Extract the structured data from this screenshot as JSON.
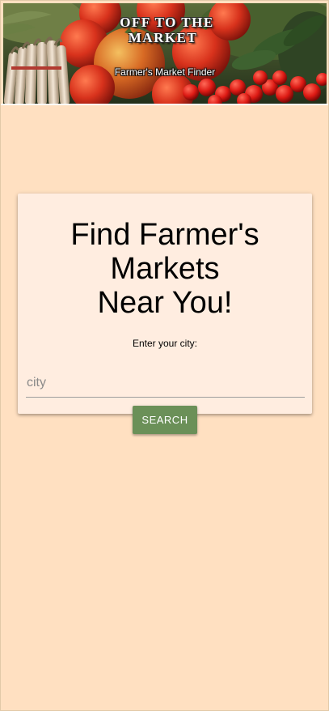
{
  "banner": {
    "logo_line1": "OFF TO THE",
    "logo_line2": "MARKET",
    "subtitle": "Farmer's Market Finder"
  },
  "search_card": {
    "title_line1": "Find Farmer's Markets",
    "title_line2": "Near You!",
    "city_label": "Enter your city:",
    "city_input": {
      "placeholder": "city",
      "value": ""
    },
    "search_button_label": "SEARCH"
  },
  "colors": {
    "page_background": "#ffe0c1",
    "card_background": "#ffede0",
    "button_background": "#6b9058",
    "button_text": "#ffffff"
  }
}
